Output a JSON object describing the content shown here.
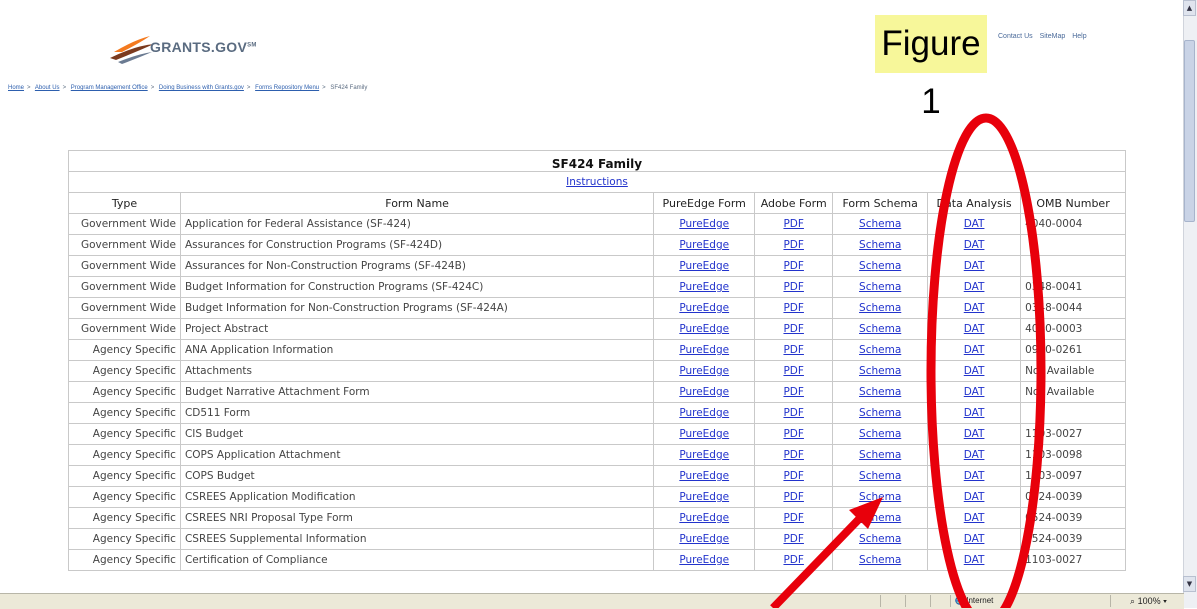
{
  "header": {
    "logo_text": "GRANTS.GOV",
    "logo_tm": "SM",
    "top_links": [
      "Contact Us",
      "SiteMap",
      "Help"
    ],
    "figure_label": "Figure 1"
  },
  "breadcrumb": [
    "Home",
    "About Us",
    "Program Management Office",
    "Doing Business with Grants.gov",
    "Forms Repository Menu",
    "SF424 Family"
  ],
  "table": {
    "title": "SF424 Family",
    "instructions": "Instructions",
    "columns": [
      "Type",
      "Form Name",
      "PureEdge Form",
      "Adobe Form",
      "Form Schema",
      "Data Analysis",
      "OMB Number"
    ],
    "rows": [
      {
        "type": "Government Wide",
        "name": "Application for Federal Assistance (SF-424)",
        "pureedge": "PureEdge",
        "adobe": "PDF",
        "schema": "Schema",
        "dat": "DAT",
        "omb": "4040-0004"
      },
      {
        "type": "Government Wide",
        "name": "Assurances for Construction Programs (SF-424D)",
        "pureedge": "PureEdge",
        "adobe": "PDF",
        "schema": "Schema",
        "dat": "DAT",
        "omb": ""
      },
      {
        "type": "Government Wide",
        "name": "Assurances for Non-Construction Programs (SF-424B)",
        "pureedge": "PureEdge",
        "adobe": "PDF",
        "schema": "Schema",
        "dat": "DAT",
        "omb": ""
      },
      {
        "type": "Government Wide",
        "name": "Budget Information for Construction Programs (SF-424C)",
        "pureedge": "PureEdge",
        "adobe": "PDF",
        "schema": "Schema",
        "dat": "DAT",
        "omb": "0348-0041"
      },
      {
        "type": "Government Wide",
        "name": "Budget Information for Non-Construction Programs (SF-424A)",
        "pureedge": "PureEdge",
        "adobe": "PDF",
        "schema": "Schema",
        "dat": "DAT",
        "omb": "0348-0044"
      },
      {
        "type": "Government Wide",
        "name": "Project Abstract",
        "pureedge": "PureEdge",
        "adobe": "PDF",
        "schema": "Schema",
        "dat": "DAT",
        "omb": "4040-0003"
      },
      {
        "type": "Agency Specific",
        "name": "ANA Application Information",
        "pureedge": "PureEdge",
        "adobe": "PDF",
        "schema": "Schema",
        "dat": "DAT",
        "omb": "0970-0261"
      },
      {
        "type": "Agency Specific",
        "name": "Attachments",
        "pureedge": "PureEdge",
        "adobe": "PDF",
        "schema": "Schema",
        "dat": "DAT",
        "omb": "Not Available"
      },
      {
        "type": "Agency Specific",
        "name": "Budget Narrative Attachment Form",
        "pureedge": "PureEdge",
        "adobe": "PDF",
        "schema": "Schema",
        "dat": "DAT",
        "omb": "Not Available"
      },
      {
        "type": "Agency Specific",
        "name": "CD511 Form",
        "pureedge": "PureEdge",
        "adobe": "PDF",
        "schema": "Schema",
        "dat": "DAT",
        "omb": ""
      },
      {
        "type": "Agency Specific",
        "name": "CIS Budget",
        "pureedge": "PureEdge",
        "adobe": "PDF",
        "schema": "Schema",
        "dat": "DAT",
        "omb": "1103-0027"
      },
      {
        "type": "Agency Specific",
        "name": "COPS Application Attachment",
        "pureedge": "PureEdge",
        "adobe": "PDF",
        "schema": "Schema",
        "dat": "DAT",
        "omb": "1103-0098"
      },
      {
        "type": "Agency Specific",
        "name": "COPS Budget",
        "pureedge": "PureEdge",
        "adobe": "PDF",
        "schema": "Schema",
        "dat": "DAT",
        "omb": "1103-0097"
      },
      {
        "type": "Agency Specific",
        "name": "CSREES Application Modification",
        "pureedge": "PureEdge",
        "adobe": "PDF",
        "schema": "Schema",
        "dat": "DAT",
        "omb": "0524-0039"
      },
      {
        "type": "Agency Specific",
        "name": "CSREES NRI Proposal Type Form",
        "pureedge": "PureEdge",
        "adobe": "PDF",
        "schema": "Schema",
        "dat": "DAT",
        "omb": "0524-0039"
      },
      {
        "type": "Agency Specific",
        "name": "CSREES Supplemental Information",
        "pureedge": "PureEdge",
        "adobe": "PDF",
        "schema": "Schema",
        "dat": "DAT",
        "omb": "0524-0039"
      },
      {
        "type": "Agency Specific",
        "name": "Certification of Compliance",
        "pureedge": "PureEdge",
        "adobe": "PDF",
        "schema": "Schema",
        "dat": "DAT",
        "omb": "1103-0027"
      }
    ]
  },
  "statusbar": {
    "zone": "Internet",
    "zoom": "100%"
  },
  "colors": {
    "annotation": "#e8000b",
    "figure_bg": "#f7f79a",
    "link": "#2233cc"
  },
  "icons": [
    "grants-gov-logo-swoosh-icon",
    "internet-zone-globe-icon",
    "zoom-icon",
    "annotation-ellipse",
    "annotation-arrow"
  ]
}
